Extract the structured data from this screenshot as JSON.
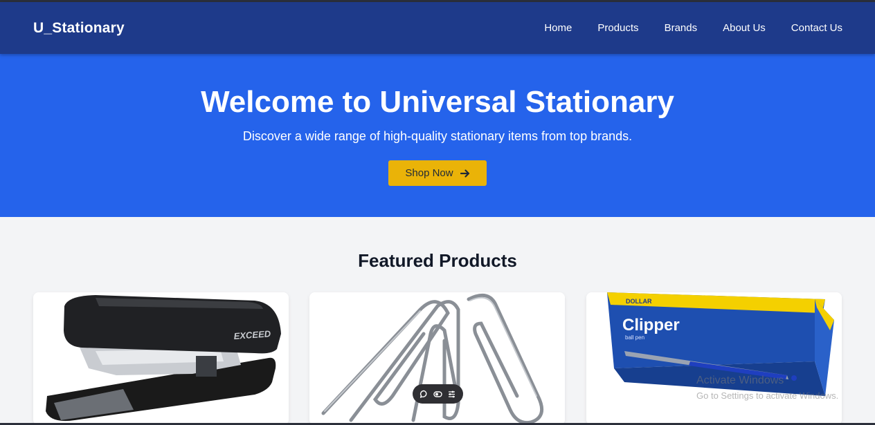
{
  "navbar": {
    "brand": "U_Stationary",
    "links": [
      "Home",
      "Products",
      "Brands",
      "About Us",
      "Contact Us"
    ]
  },
  "hero": {
    "title": "Welcome to Universal Stationary",
    "subtitle": "Discover a wide range of high-quality stationary items from top brands.",
    "cta_label": "Shop Now",
    "cta_icon": "arrow-right-icon"
  },
  "featured": {
    "title": "Featured Products",
    "products": [
      {
        "image_text": "EXCEED",
        "image": "stapler"
      },
      {
        "image": "paper-clips"
      },
      {
        "image_text_top": "DOLLAR",
        "image_text_main": "Clipper",
        "image_text_sub": "ball pen",
        "image": "pen-box"
      }
    ]
  },
  "floating_toolbar": {
    "icons": [
      "comment-icon",
      "toggle-icon",
      "sliders-icon"
    ]
  },
  "watermark": {
    "title": "Activate Windows",
    "subtitle": "Go to Settings to activate Windows."
  },
  "colors": {
    "navbar": "#1e3a8a",
    "hero": "#2563eb",
    "cta": "#eab308",
    "page_bg": "#f3f4f6"
  }
}
